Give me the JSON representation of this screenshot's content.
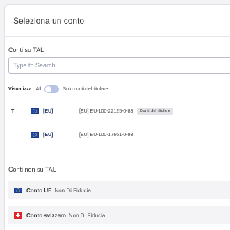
{
  "header": {
    "title": "Seleziona un conto"
  },
  "tal_section": {
    "title": "Conti su TAL",
    "search_placeholder": "Type to Search",
    "filter": {
      "label": "Visualizza:",
      "all": "All",
      "owner_only": "Solo conti del titolare"
    },
    "accounts": [
      {
        "marker": "T",
        "flag": "eu-flag-icon",
        "code": "[EU]",
        "full": "[EU] EU-100-22125-0-83",
        "badge": "Conti del titolare"
      },
      {
        "marker": "",
        "flag": "eu-flag-icon",
        "code": "[EU]",
        "full": "[EU] EU-100-17661-0-93",
        "badge": ""
      }
    ]
  },
  "non_tal_section": {
    "title": "Conti non su TAL",
    "items": [
      {
        "flag": "eu-flag-icon",
        "name": "Conto UE",
        "trust": "Non Di Fiducia"
      },
      {
        "flag": "swiss-flag-icon",
        "name": "Conto svizzero",
        "trust": "Non Di Fiducia"
      }
    ]
  },
  "colors": {
    "accent": "#1f48a8",
    "toggle_off": "#b7c4e6",
    "swiss_red": "#e0242c"
  }
}
